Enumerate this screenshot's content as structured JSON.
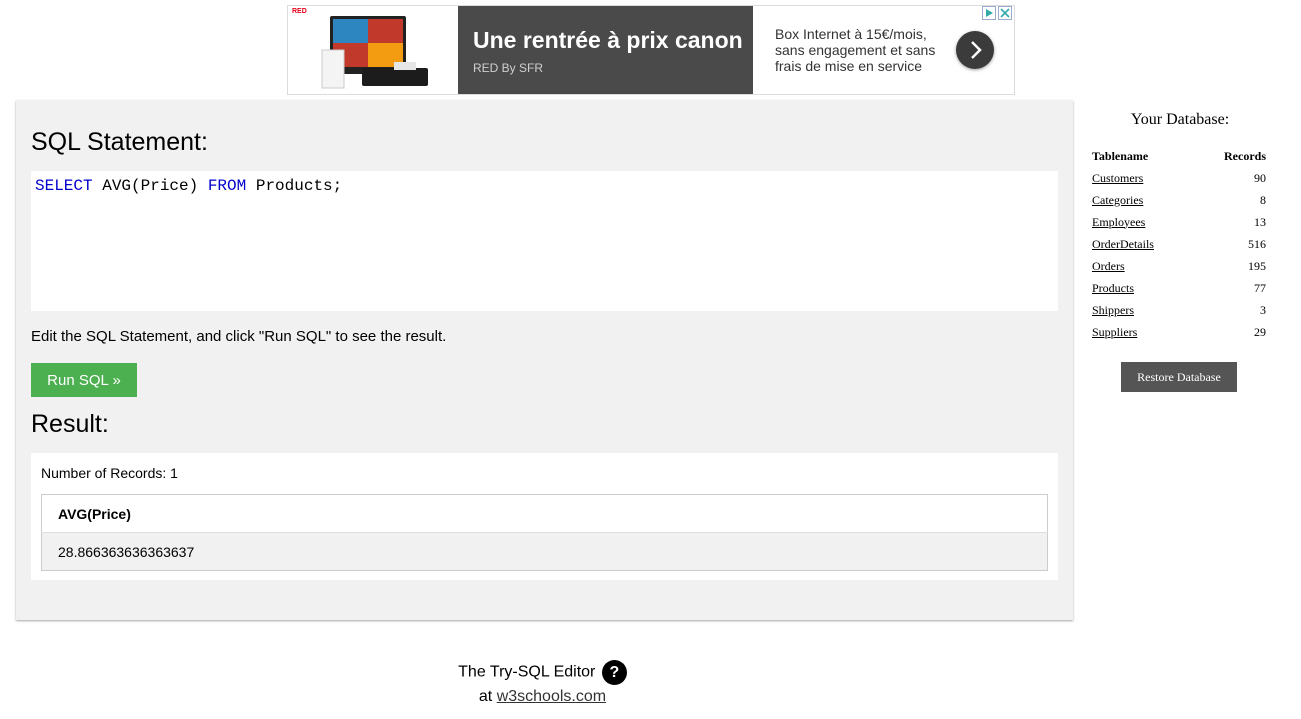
{
  "ad": {
    "logo": "RED",
    "headline": "Une rentrée à prix canon",
    "brand": "RED By SFR",
    "text": "Box Internet à 15€/mois, sans engagement et sans frais de mise en service",
    "next_icon": "chevron-right-icon",
    "choices_icons": [
      "adchoices-icon",
      "close-icon"
    ],
    "colors": {
      "dark_panel": "#4a4a4a",
      "logo": "#e2001a"
    }
  },
  "editor": {
    "title": "SQL Statement:",
    "code": {
      "kw1": "SELECT",
      "mid": " AVG(Price) ",
      "kw2": "FROM",
      "rest": " Products;"
    },
    "instruction": "Edit the SQL Statement, and click \"Run SQL\" to see the result.",
    "run_label": "Run SQL »",
    "colors": {
      "keyword": "#0000cd",
      "run_button": "#4caf50"
    }
  },
  "result": {
    "title": "Result:",
    "record_count": "Number of Records: 1",
    "columns": [
      "AVG(Price)"
    ],
    "rows": [
      [
        "28.866363636363637"
      ]
    ]
  },
  "sidebar": {
    "title": "Your Database:",
    "headers": {
      "name": "Tablename",
      "records": "Records"
    },
    "tables": [
      {
        "name": "Customers",
        "records": "90"
      },
      {
        "name": "Categories",
        "records": "8"
      },
      {
        "name": "Employees",
        "records": "13"
      },
      {
        "name": "OrderDetails",
        "records": "516"
      },
      {
        "name": "Orders",
        "records": "195"
      },
      {
        "name": "Products",
        "records": "77"
      },
      {
        "name": "Shippers",
        "records": "3"
      },
      {
        "name": "Suppliers",
        "records": "29"
      }
    ],
    "restore_label": "Restore Database"
  },
  "footer": {
    "line1": "The Try-SQL Editor",
    "help_glyph": "?",
    "at": "at",
    "link": "w3schools.com"
  }
}
